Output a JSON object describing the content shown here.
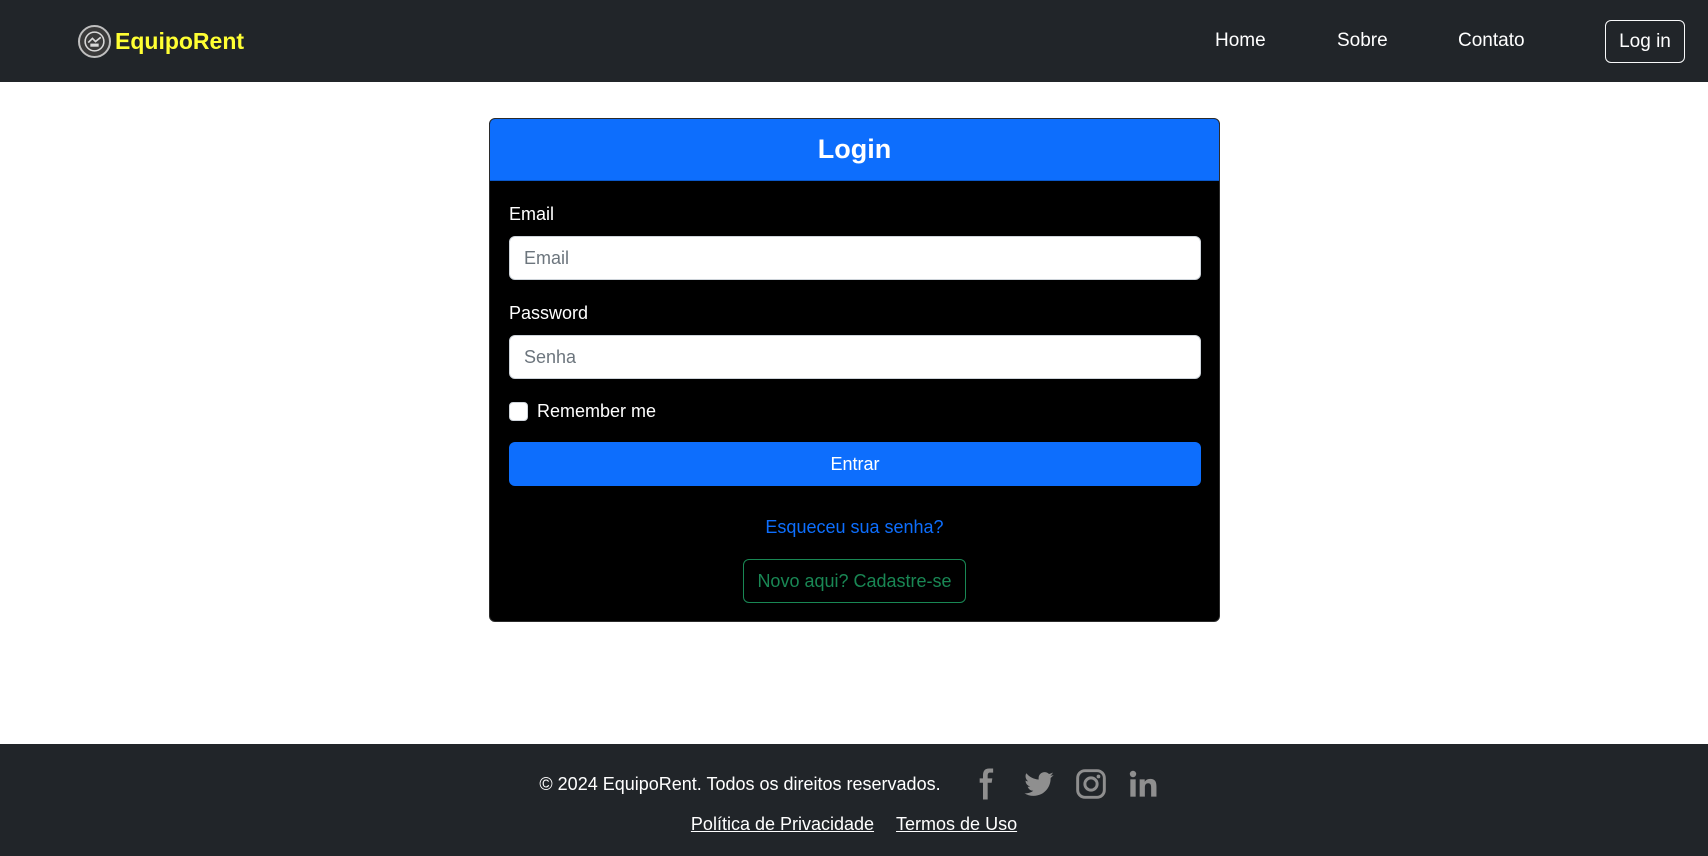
{
  "navbar": {
    "brand": "EquipoRent",
    "links": [
      "Home",
      "Sobre",
      "Contato"
    ],
    "login_button": "Log in"
  },
  "login_card": {
    "title": "Login",
    "email_label": "Email",
    "email_placeholder": "Email",
    "password_label": "Password",
    "password_placeholder": "Senha",
    "remember_label": "Remember me",
    "submit_label": "Entrar",
    "forgot_link": "Esqueceu sua senha?",
    "register_button": "Novo aqui? Cadastre-se"
  },
  "footer": {
    "copyright": "© 2024 EquipoRent. Todos os direitos reservados.",
    "social_icons": [
      "facebook-icon",
      "twitter-icon",
      "instagram-icon",
      "linkedin-icon"
    ],
    "links": [
      "Política de Privacidade",
      "Termos de Uso"
    ]
  },
  "colors": {
    "navbar_bg": "#212529",
    "brand_text": "#ffff33",
    "primary": "#0d6efd",
    "success": "#198754",
    "card_bg": "#000000",
    "social_icon": "#8f8f8f"
  }
}
